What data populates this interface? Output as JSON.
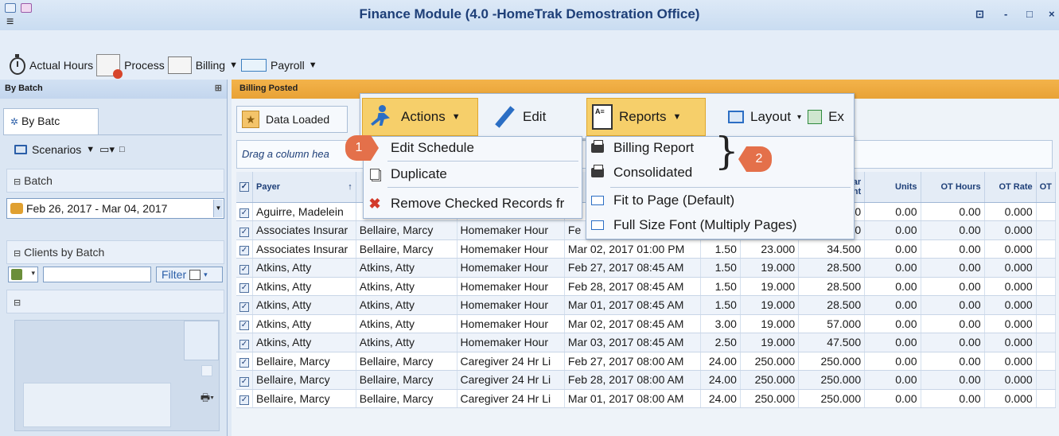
{
  "window": {
    "title": "Finance Module (4.0 -HomeTrak Demostration Office)",
    "controls": [
      "⊡",
      "-",
      "□",
      "×"
    ]
  },
  "toolbar": {
    "actual_hours": "Actual Hours",
    "process": "Process",
    "billing": "Billing",
    "payroll": "Payroll"
  },
  "left_panel": {
    "header": "By Batch",
    "tab": "By Batc",
    "scenarios": "Scenarios",
    "batch_group": "Batch",
    "date_range": "Feb 26, 2017 - Mar 04, 2017",
    "clients_group": "Clients by Batch",
    "filter_label": "Filter"
  },
  "main": {
    "header": "Billing Posted",
    "data_loaded": "Data Loaded",
    "group_hint": "Drag a column hea"
  },
  "ribbon": {
    "actions": "Actions",
    "edit": "Edit",
    "reports": "Reports",
    "layout": "Layout",
    "export_partial": "Ex"
  },
  "actions_menu": {
    "items": [
      "Edit Schedule",
      "Duplicate",
      "Remove Checked Records fr"
    ]
  },
  "reports_menu": {
    "items": [
      "Billing Report",
      "Consolidated",
      "Fit to Page (Default)",
      "Full Size Font (Multiply Pages)"
    ]
  },
  "callouts": {
    "one": "1",
    "two": "2"
  },
  "grid": {
    "columns": {
      "payer": "Payer",
      "col3_partial": "ular",
      "col3_partial2": "unt",
      "units": "Units",
      "ot_hours": "OT Hours",
      "ot_rate": "OT Rate",
      "ot_partial": "OT"
    },
    "rows": [
      {
        "payer": "Aguirre, Madelein",
        "client": "",
        "service": "",
        "date": "",
        "hours": "",
        "rate": "",
        "amount": "00",
        "units": "0.00",
        "ot_hours": "0.00",
        "ot_rate": "0.000"
      },
      {
        "payer": "Associates Insurar",
        "client": "Bellaire, Marcy",
        "service": "Homemaker Hour",
        "date": "Fe",
        "hours": "",
        "rate": "",
        "amount": "00",
        "units": "0.00",
        "ot_hours": "0.00",
        "ot_rate": "0.000"
      },
      {
        "payer": "Associates Insurar",
        "client": "Bellaire, Marcy",
        "service": "Homemaker Hour",
        "date": "Mar 02, 2017  01:00 PM",
        "hours": "1.50",
        "rate": "23.000",
        "amount": "34.500",
        "units": "0.00",
        "ot_hours": "0.00",
        "ot_rate": "0.000"
      },
      {
        "payer": "Atkins, Atty",
        "client": "Atkins, Atty",
        "service": "Homemaker Hour",
        "date": "Feb 27, 2017  08:45 AM",
        "hours": "1.50",
        "rate": "19.000",
        "amount": "28.500",
        "units": "0.00",
        "ot_hours": "0.00",
        "ot_rate": "0.000"
      },
      {
        "payer": "Atkins, Atty",
        "client": "Atkins, Atty",
        "service": "Homemaker Hour",
        "date": "Feb 28, 2017  08:45 AM",
        "hours": "1.50",
        "rate": "19.000",
        "amount": "28.500",
        "units": "0.00",
        "ot_hours": "0.00",
        "ot_rate": "0.000"
      },
      {
        "payer": "Atkins, Atty",
        "client": "Atkins, Atty",
        "service": "Homemaker Hour",
        "date": "Mar 01, 2017  08:45 AM",
        "hours": "1.50",
        "rate": "19.000",
        "amount": "28.500",
        "units": "0.00",
        "ot_hours": "0.00",
        "ot_rate": "0.000"
      },
      {
        "payer": "Atkins, Atty",
        "client": "Atkins, Atty",
        "service": "Homemaker Hour",
        "date": "Mar 02, 2017  08:45 AM",
        "hours": "3.00",
        "rate": "19.000",
        "amount": "57.000",
        "units": "0.00",
        "ot_hours": "0.00",
        "ot_rate": "0.000"
      },
      {
        "payer": "Atkins, Atty",
        "client": "Atkins, Atty",
        "service": "Homemaker Hour",
        "date": "Mar 03, 2017  08:45 AM",
        "hours": "2.50",
        "rate": "19.000",
        "amount": "47.500",
        "units": "0.00",
        "ot_hours": "0.00",
        "ot_rate": "0.000"
      },
      {
        "payer": "Bellaire, Marcy",
        "client": "Bellaire, Marcy",
        "service": "Caregiver 24 Hr Li",
        "date": "Feb 27, 2017  08:00 AM",
        "hours": "24.00",
        "rate": "250.000",
        "amount": "250.000",
        "units": "0.00",
        "ot_hours": "0.00",
        "ot_rate": "0.000"
      },
      {
        "payer": "Bellaire, Marcy",
        "client": "Bellaire, Marcy",
        "service": "Caregiver 24 Hr Li",
        "date": "Feb 28, 2017  08:00 AM",
        "hours": "24.00",
        "rate": "250.000",
        "amount": "250.000",
        "units": "0.00",
        "ot_hours": "0.00",
        "ot_rate": "0.000"
      },
      {
        "payer": "Bellaire, Marcy",
        "client": "Bellaire, Marcy",
        "service": "Caregiver 24 Hr Li",
        "date": "Mar 01, 2017  08:00 AM",
        "hours": "24.00",
        "rate": "250.000",
        "amount": "250.000",
        "units": "0.00",
        "ot_hours": "0.00",
        "ot_rate": "0.000"
      }
    ]
  }
}
